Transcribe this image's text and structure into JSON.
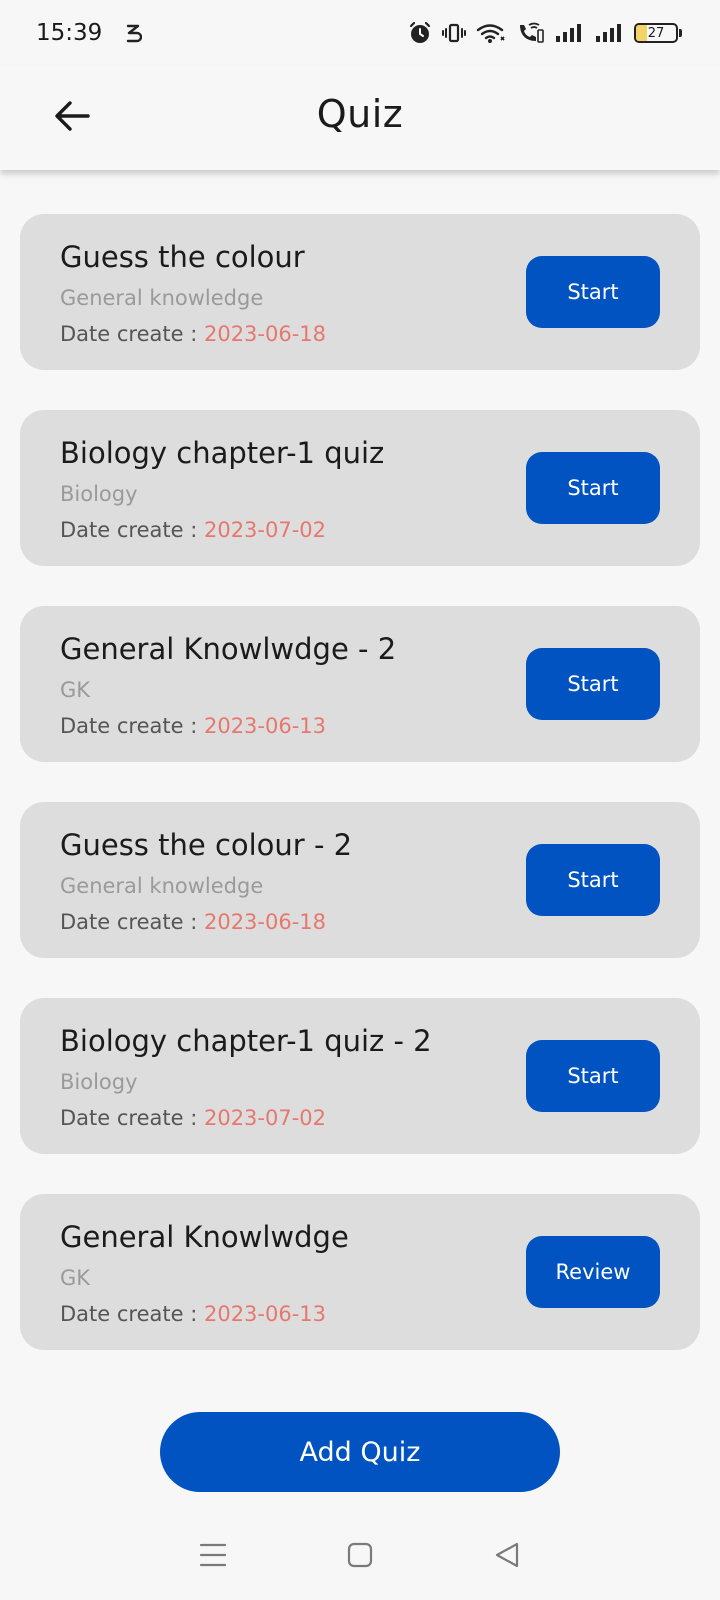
{
  "status_bar": {
    "time": "15:39",
    "battery_level": "27",
    "icons": [
      "s-icon",
      "alarm-icon",
      "vibrate-icon",
      "wifi-icon",
      "wifi-calling-icon",
      "signal-icon",
      "signal-icon",
      "battery-icon"
    ]
  },
  "app_bar": {
    "title": "Quiz",
    "back_icon": "arrow-left-icon"
  },
  "quizzes": [
    {
      "title": "Guess the colour",
      "category": "General knowledge",
      "date_label": "Date create : ",
      "date": "2023-06-18",
      "action": "Start"
    },
    {
      "title": "Biology chapter-1 quiz",
      "category": "Biology",
      "date_label": "Date create : ",
      "date": "2023-07-02",
      "action": "Start"
    },
    {
      "title": "General Knowlwdge - 2",
      "category": "GK",
      "date_label": "Date create : ",
      "date": "2023-06-13",
      "action": "Start"
    },
    {
      "title": "Guess the colour - 2",
      "category": "General knowledge",
      "date_label": "Date create : ",
      "date": "2023-06-18",
      "action": "Start"
    },
    {
      "title": "Biology chapter-1 quiz - 2",
      "category": "Biology",
      "date_label": "Date create : ",
      "date": "2023-07-02",
      "action": "Start"
    },
    {
      "title": "General Knowlwdge",
      "category": "GK",
      "date_label": "Date create : ",
      "date": "2023-06-13",
      "action": "Review"
    }
  ],
  "add_quiz_label": "Add Quiz",
  "nav_bar": {
    "icons": [
      "menu-icon",
      "home-icon",
      "back-icon"
    ]
  },
  "colors": {
    "primary": "#0053c0",
    "card_background": "#dddddd",
    "date_color": "#e6786e",
    "category_color": "#9a9a9a",
    "page_background": "#f7f7f7"
  }
}
